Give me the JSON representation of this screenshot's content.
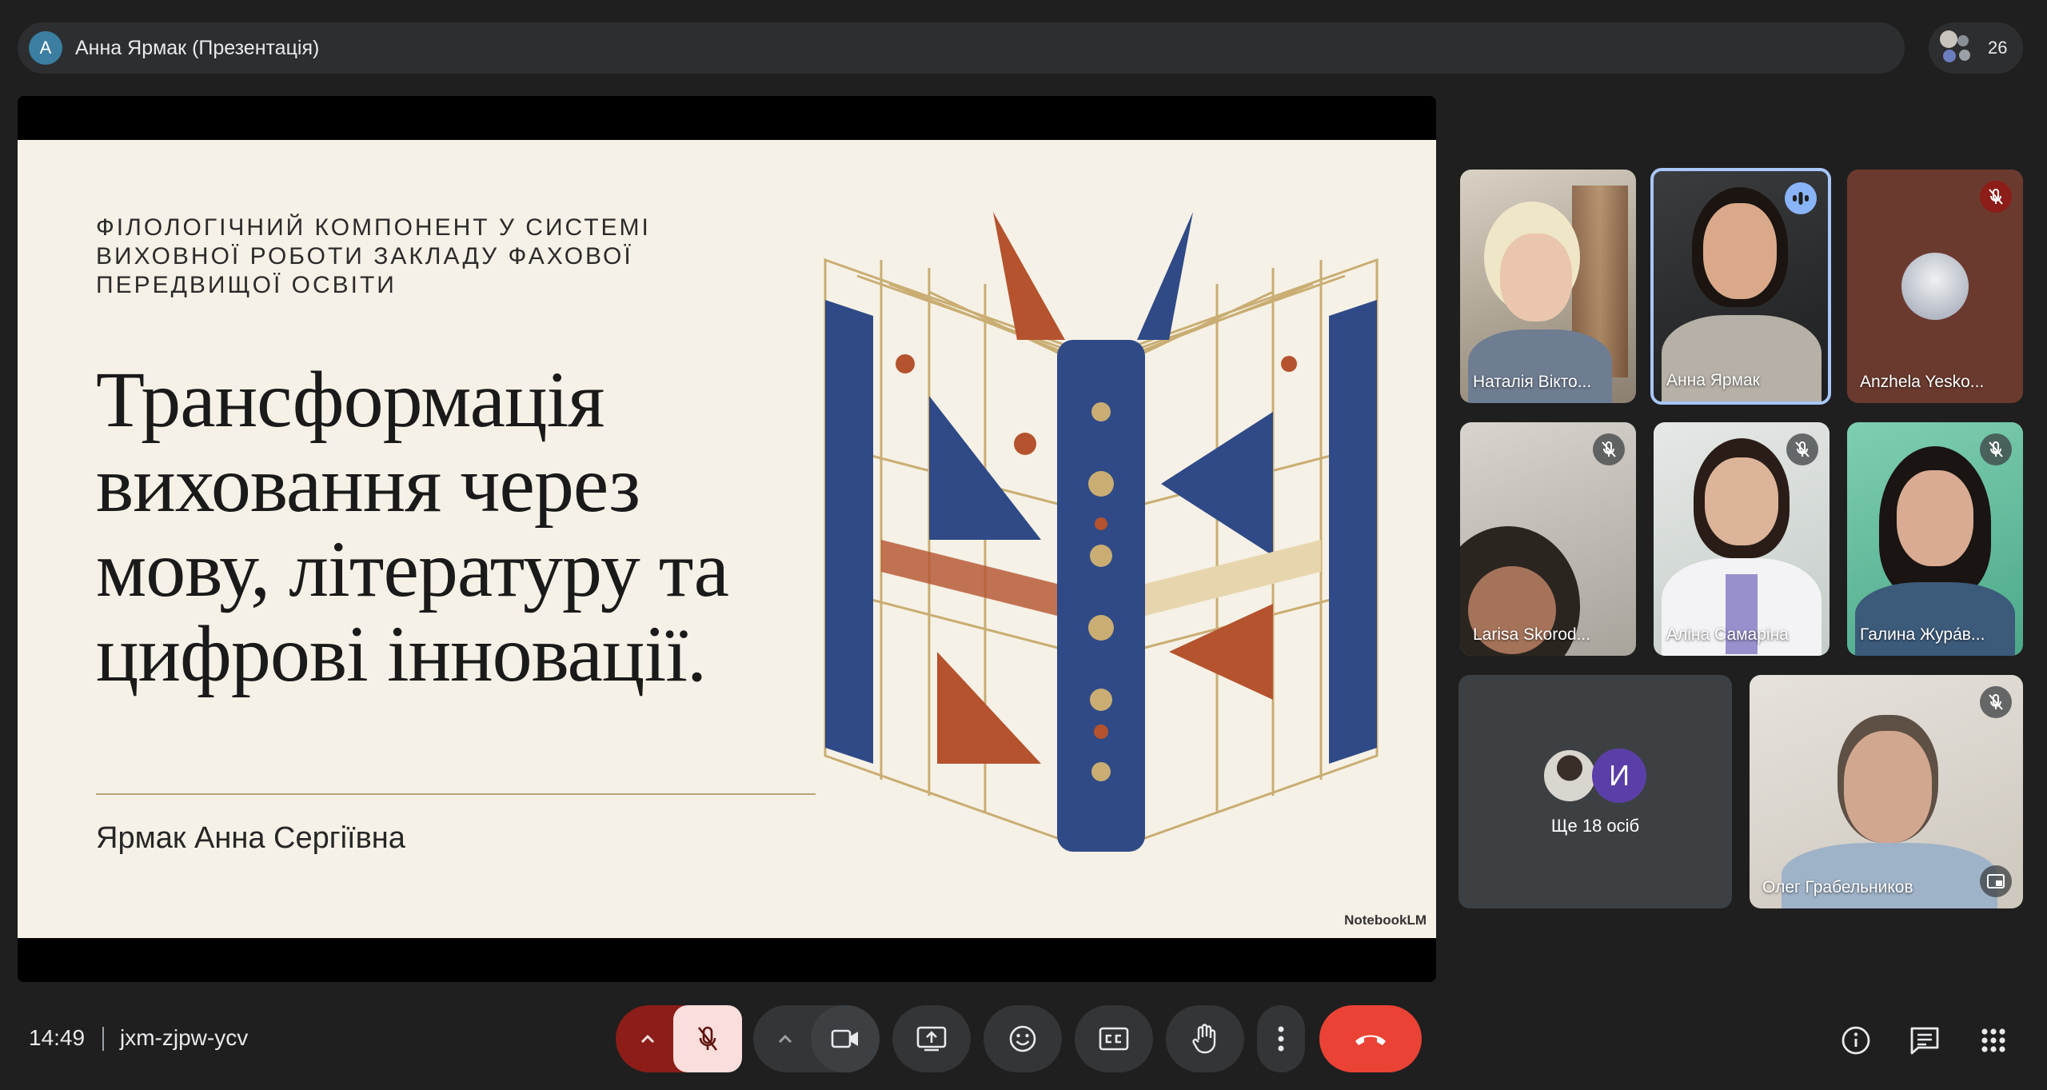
{
  "topbar": {
    "presenter_initial": "А",
    "presenter_label": "Анна Ярмак (Презентація)",
    "participant_count": "26"
  },
  "slide": {
    "kicker": "ФІЛОЛОГІЧНИЙ КОМПОНЕНТ У СИСТЕМІ\nВИХОВНОЇ РОБОТИ ЗАКЛАДУ ФАХОВОЇ\nПЕРЕДВИЩОЇ ОСВІТИ",
    "headline": "Трансформація\nвиховання через\nмову, літературу та\nцифрові інновації.",
    "author": "Ярмак Анна Сергіївна",
    "watermark": "NotebookLM"
  },
  "tiles": [
    {
      "name": "Наталія Вікто...",
      "muted": false
    },
    {
      "name": "Анна Ярмак",
      "speaking": true
    },
    {
      "name": "Anzhela Yesko...",
      "muted": true
    },
    {
      "name": "Larisa Skorod...",
      "muted": true
    },
    {
      "name": "Аліна Самаріна",
      "muted": true
    },
    {
      "name": "Галина Жура́в...",
      "muted": true
    },
    {
      "name": "Ще 18 осіб",
      "initial": "И"
    },
    {
      "name": "Олег Грабельников",
      "muted": true
    }
  ],
  "bottombar": {
    "time": "14:49",
    "meeting_code": "jxm-zjpw-ycv"
  },
  "icons": {
    "mic": "mic-off-icon",
    "camera": "videocam-icon",
    "present": "present-screen-icon",
    "reactions": "emoji-icon",
    "captions": "closed-captions-icon",
    "hand": "raise-hand-icon",
    "more": "more-vert-icon",
    "leave": "call-end-icon",
    "info": "info-icon",
    "chat": "chat-icon",
    "activities": "apps-grid-icon"
  },
  "colors": {
    "leave": "#ea4335",
    "mic_off_bg": "#f9dedc",
    "mic_off_group": "#8c1d18",
    "speaking_ring": "#a8c7fa"
  }
}
